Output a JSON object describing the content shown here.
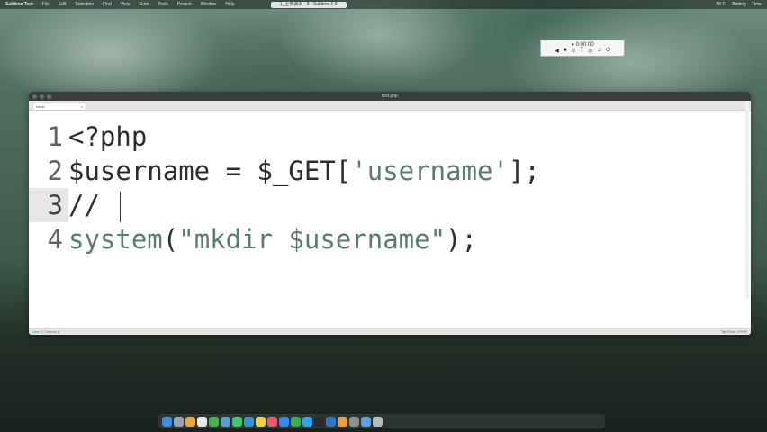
{
  "menubar": {
    "app_name": "Sublime Text",
    "items": [
      "File",
      "Edit",
      "Selection",
      "Find",
      "View",
      "Goto",
      "Tools",
      "Project",
      "Window",
      "Help"
    ],
    "center_tab": "1_上传漏洞 - 8 - Sublime 2-8",
    "right_items": [
      "Wi-Fi",
      "Battery",
      "Time"
    ]
  },
  "recorder": {
    "title": "● 0:00:00",
    "buttons": [
      "◀",
      "■",
      "⊙",
      "T",
      "◎",
      "♫",
      "⏻"
    ]
  },
  "window": {
    "title": "test.php",
    "tab_label": "mkdir",
    "tab_close": "×"
  },
  "editor": {
    "lines": [
      {
        "num": "1",
        "parts": [
          {
            "t": "<?php",
            "c": "code"
          }
        ]
      },
      {
        "num": "2",
        "parts": [
          {
            "t": "$username = $_GET[",
            "c": "code"
          },
          {
            "t": "'username'",
            "c": "str"
          },
          {
            "t": "];",
            "c": "code"
          }
        ]
      },
      {
        "num": "3",
        "parts": [
          {
            "t": "//",
            "c": "code"
          }
        ],
        "current": true
      },
      {
        "num": "4",
        "parts": [
          {
            "t": "system",
            "c": "kw"
          },
          {
            "t": "(",
            "c": "code"
          },
          {
            "t": "\"mkdir $username\"",
            "c": "str"
          },
          {
            "t": ");",
            "c": "code"
          }
        ]
      }
    ]
  },
  "statusbar": {
    "left": "Line 3, Column 4",
    "right": "Tab Size: 4    PHP"
  },
  "dock": {
    "icons": [
      "finder-icon",
      "launchpad-icon",
      "photos-icon",
      "calendar-icon",
      "chrome-icon",
      "mail-icon",
      "messages-icon",
      "safari-icon",
      "notes-icon",
      "music-icon",
      "appstore-icon",
      "wechat-icon",
      "qq-icon",
      "terminal-icon",
      "vscode-icon",
      "sublime-icon",
      "preferences-icon",
      "folder-icon",
      "trash-icon"
    ]
  }
}
